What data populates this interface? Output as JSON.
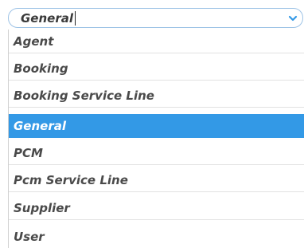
{
  "select": {
    "value": "General",
    "chevron_icon": "chevron-down-icon",
    "accent_color": "#3399e6"
  },
  "options": [
    {
      "label": "Agent"
    },
    {
      "label": "Booking"
    },
    {
      "label": "Booking Service Line"
    },
    {
      "label": "General",
      "selected": true
    },
    {
      "label": "PCM"
    },
    {
      "label": "Pcm Service Line"
    },
    {
      "label": "Supplier"
    },
    {
      "label": "User"
    }
  ]
}
